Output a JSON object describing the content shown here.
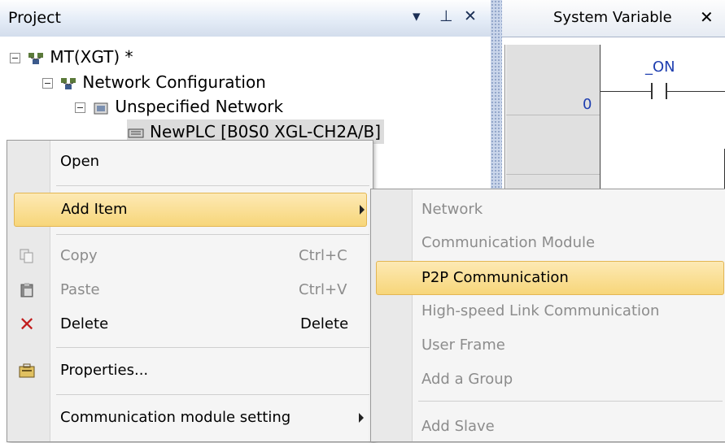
{
  "project_panel": {
    "title": "Project",
    "tree": [
      {
        "label": "MT(XGT) *"
      },
      {
        "label": "Network Configuration"
      },
      {
        "label": "Unspecified Network"
      },
      {
        "label": "NewPLC [B0S0 XGL-CH2A/B]"
      }
    ]
  },
  "editor": {
    "tab_label": "System Variable",
    "row_number": "0",
    "contact_label": "_ON"
  },
  "context_menu": {
    "items": [
      {
        "label": "Open"
      },
      {
        "label": "Add Item"
      },
      {
        "label": "Copy",
        "shortcut": "Ctrl+C"
      },
      {
        "label": "Paste",
        "shortcut": "Ctrl+V"
      },
      {
        "label": "Delete",
        "shortcut": "Delete"
      },
      {
        "label": "Properties..."
      },
      {
        "label": "Communication module setting"
      }
    ]
  },
  "submenu": {
    "items": [
      {
        "label": "Network"
      },
      {
        "label": "Communication Module"
      },
      {
        "label": "P2P Communication"
      },
      {
        "label": "High-speed Link Communication"
      },
      {
        "label": "User Frame"
      },
      {
        "label": "Add a Group"
      },
      {
        "label": "Add Slave"
      }
    ]
  },
  "colors": {
    "highlight": "#f7d67a",
    "panel_header": "#d3ddec",
    "disabled_text": "#8c8c8c"
  }
}
